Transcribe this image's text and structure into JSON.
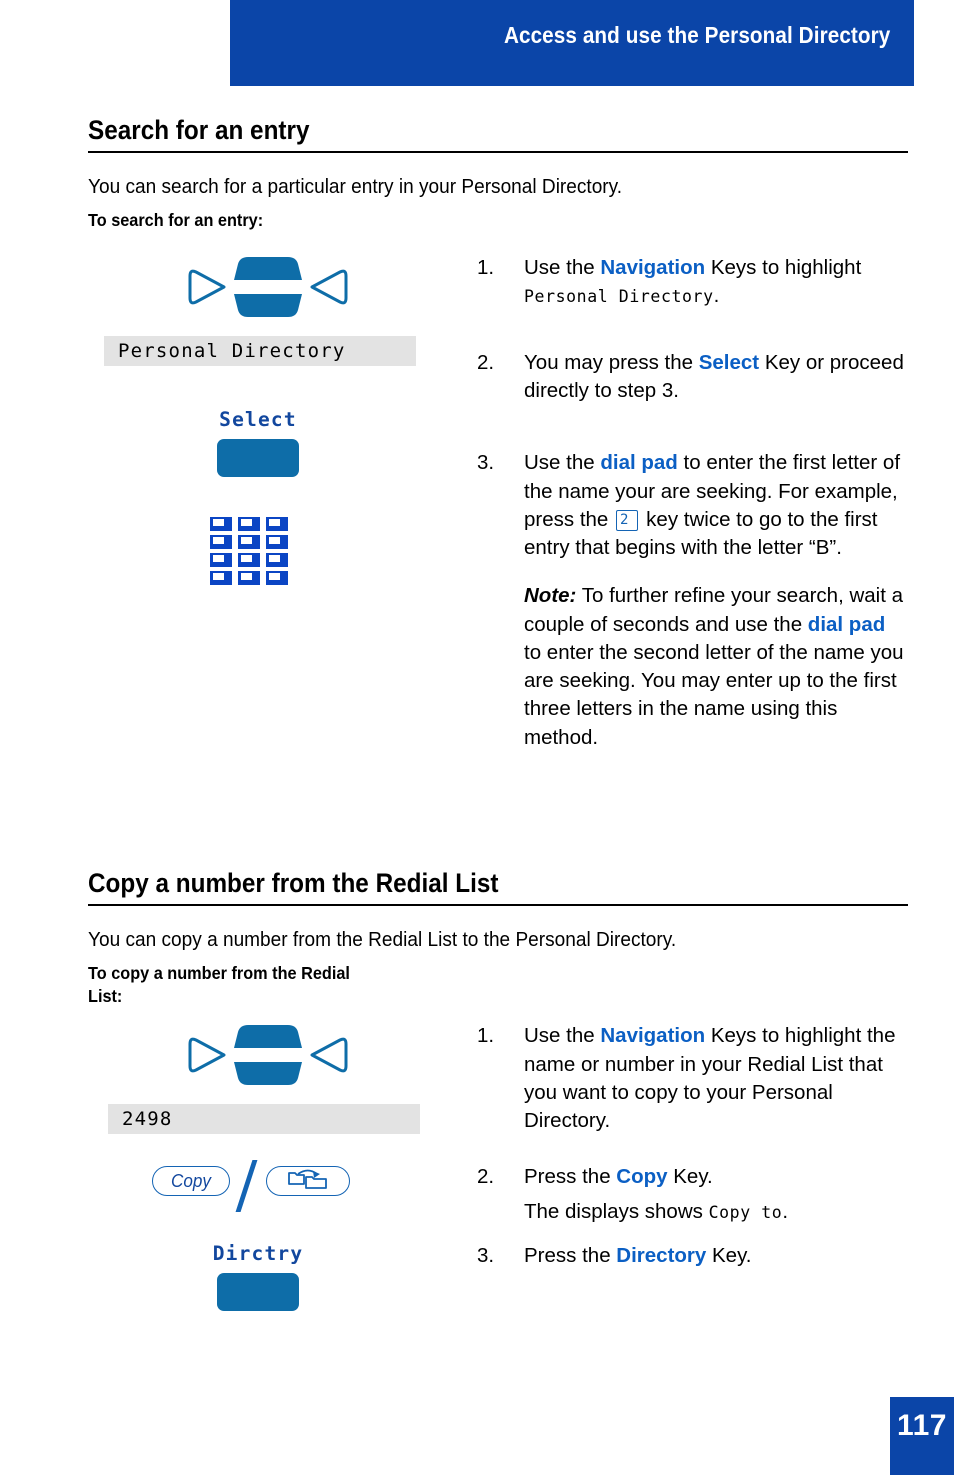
{
  "header": {
    "title": "Access and use the Personal Directory"
  },
  "page_number": "117",
  "sections": [
    {
      "heading": "Search for an entry",
      "intro": "You can search for a particular entry in your Personal Directory.",
      "subhead": "To search for an entry:",
      "graphics": {
        "nav_key_name": "navigation-keys-icon",
        "display_text": "Personal Directory",
        "softkey_label": "Select",
        "dialpad_name": "dial-pad-icon"
      },
      "steps": [
        {
          "number": "1.",
          "prefix": "Use the ",
          "keyword": "Navigation",
          "middle": " Keys to highlight ",
          "lcd": "Personal Directory",
          "suffix": "."
        },
        {
          "number": "2.",
          "prefix": "You may press the ",
          "keyword": "Select",
          "middle": " Key or proceed directly to step 3.",
          "lcd": "",
          "suffix": ""
        },
        {
          "number": "3.",
          "prefix": "Use the ",
          "keyword": "dial pad",
          "middle": " to enter the first letter of the name your are seeking. For example, press the ",
          "keybox": "2",
          "suffix": " key twice to go to the first entry that begins with the letter “B”."
        }
      ],
      "note": {
        "label": "Note:",
        "prefix": " To further refine your search, wait a couple of seconds and use the ",
        "keyword": "dial pad",
        "suffix": " to enter the second letter of the name you are seeking. You may enter up to the first three letters in the name using this method."
      }
    },
    {
      "heading": "Copy a number from the Redial List",
      "intro": "You can copy a number from the Redial List to the Personal Directory.",
      "subhead": "To copy a number from the Redial\nList:",
      "graphics": {
        "nav_key_name": "navigation-keys-icon",
        "display_text": "2498",
        "copy_pill_label": "Copy",
        "copy_icon_name": "copy-to-icon",
        "softkey_label": "Dirctry"
      },
      "steps": [
        {
          "number": "1.",
          "prefix": "Use the ",
          "keyword": "Navigation",
          "middle": " Keys to highlight the name or number in your Redial List that you want to copy to your Personal Directory.",
          "lcd": "",
          "suffix": ""
        },
        {
          "number": "2.",
          "prefix": "Press the ",
          "keyword": "Copy",
          "middle": " Key.",
          "lcd": "",
          "suffix": ""
        },
        {
          "number": "3.",
          "prefix": "Press the ",
          "keyword": "Directory",
          "middle": " Key.",
          "lcd": "",
          "suffix": ""
        }
      ],
      "substep": {
        "prefix": "The displays shows ",
        "lcd": "Copy to",
        "suffix": "."
      }
    }
  ],
  "colors": {
    "header_blue": "#0B45A8",
    "keyword_blue": "#0B5FC4",
    "icon_blue": "#0E6DA8",
    "dialpad_blue": "#0B45C4",
    "display_gray": "#E3E3E3"
  }
}
